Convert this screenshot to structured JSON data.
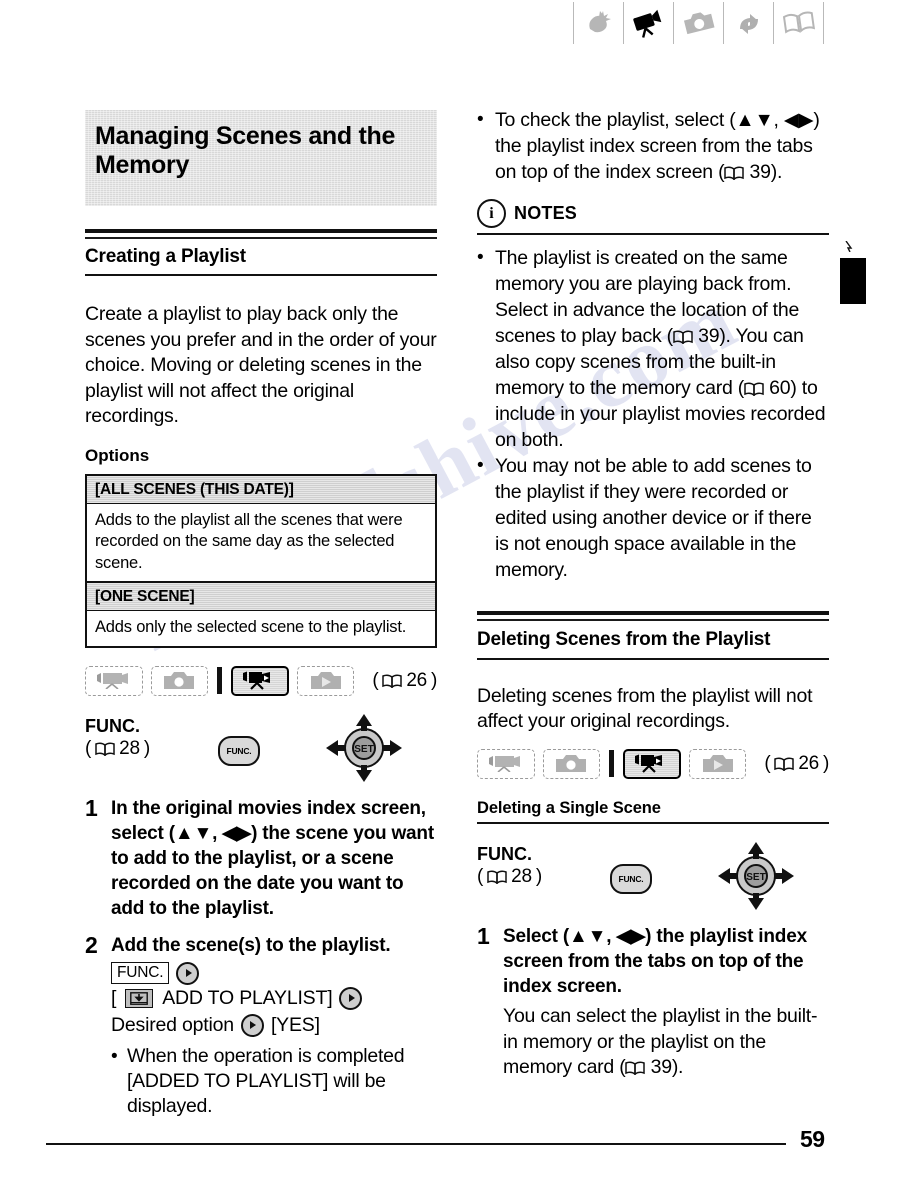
{
  "page": {
    "number": "59"
  },
  "header_tabs": [
    {
      "icon": "hand-setup-icon",
      "state": "inactive"
    },
    {
      "icon": "camcorder-video-icon",
      "state": "active"
    },
    {
      "icon": "photo-camera-icon",
      "state": "inactive"
    },
    {
      "icon": "transfer-arrows-icon",
      "state": "inactive"
    },
    {
      "icon": "open-book-icon",
      "state": "inactive"
    }
  ],
  "left_column": {
    "chapter_title": "Managing Scenes and the Memory",
    "section_title": "Creating a Playlist",
    "intro": "Create a playlist to play back only the scenes you prefer and in the order of your choice. Moving or deleting scenes in the playlist will not affect the original recordings.",
    "options_label": "Options",
    "options_table": [
      {
        "name": "[ALL SCENES (THIS DATE)]",
        "description": "Adds to the playlist all the scenes that were recorded on the same day as the selected scene."
      },
      {
        "name": "[ONE SCENE]",
        "description": "Adds only the selected scene to the playlist."
      }
    ],
    "mode_tabs": [
      {
        "icon": "movie-record-icon",
        "state": "inactive"
      },
      {
        "icon": "photo-record-icon",
        "state": "inactive"
      },
      {
        "icon": "movie-playback-icon",
        "state": "active"
      },
      {
        "icon": "photo-playback-icon",
        "state": "inactive"
      }
    ],
    "mode_tabs_pageref": "26",
    "func": {
      "label": "FUNC.",
      "pageref": "28",
      "button_label": "FUNC.",
      "joystick_label": "SET"
    },
    "steps": [
      {
        "num": "1",
        "text_parts": [
          "In the original movies index screen, select (",
          "▲▼",
          ", ",
          "◀▶",
          ") the scene you want to add to the playlist, or a scene recorded on the date you want to add to the playlist."
        ],
        "text": "In the original movies index screen, select (▲▼, ◀▶) the scene you want to add to the playlist, or a scene recorded on the date you want to add to the playlist."
      },
      {
        "num": "2",
        "text": "Add the scene(s) to the playlist.",
        "menu_path": {
          "func_chip": "FUNC.",
          "line2_label": "ADD TO PLAYLIST]",
          "line2_open": "[",
          "line2_icon": "add-to-playlist-icon",
          "line3_a": "Desired option",
          "line3_b": "[YES]"
        },
        "bullet": "When the operation is completed [ADDED TO PLAYLIST] will be displayed."
      }
    ]
  },
  "right_column": {
    "top_bullet": {
      "text": "To check the playlist, select (▲▼, ◀▶) the playlist index screen from the tabs on top of the index screen (",
      "pageref": "39",
      "tail": ")."
    },
    "notes": {
      "title": "NOTES",
      "icon": "info-circle-icon",
      "items": [
        {
          "text": "The playlist is created on the same memory you are playing back from. Select in advance the location of the scenes to play back (",
          "ref1": "39",
          "mid": "). You can also copy scenes from the built-in memory to the memory card (",
          "ref2": "60",
          "tail": ") to include in your playlist movies recorded on both."
        },
        {
          "text": "You may not be able to add scenes to the playlist if they were recorded or edited using another device or if there is not enough space available in the memory."
        }
      ]
    },
    "section_title": "Deleting Scenes from the Playlist",
    "intro": "Deleting scenes from the playlist will not affect your original recordings.",
    "mode_tabs": [
      {
        "icon": "movie-record-icon",
        "state": "inactive"
      },
      {
        "icon": "photo-record-icon",
        "state": "inactive"
      },
      {
        "icon": "movie-playback-icon",
        "state": "active"
      },
      {
        "icon": "photo-playback-icon",
        "state": "inactive"
      }
    ],
    "mode_tabs_pageref": "26",
    "sub_title": "Deleting a Single Scene",
    "func": {
      "label": "FUNC.",
      "pageref": "28",
      "button_label": "FUNC.",
      "joystick_label": "SET"
    },
    "step": {
      "num": "1",
      "text": "Select (▲▼, ◀▶) the playlist index screen from the tabs on top of the index screen.",
      "body": "You can select the playlist in the built-in memory or the playlist on the memory card (",
      "body_ref": "39",
      "body_tail": ")."
    }
  },
  "watermark": {
    "line1": "manualshive.com",
    "line2": "manuals"
  }
}
